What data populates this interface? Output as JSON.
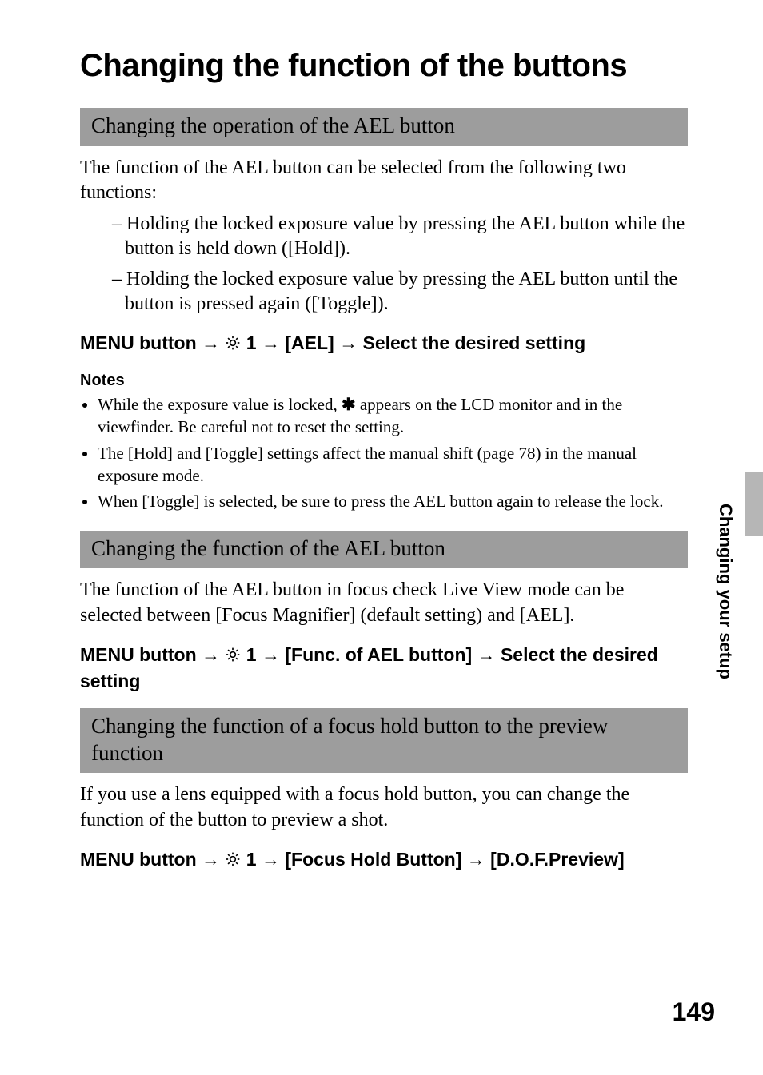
{
  "page_title": "Changing the function of the buttons",
  "side_tab": "Changing your setup",
  "page_number": "149",
  "sec1": {
    "bar": "Changing the operation of the AEL button",
    "intro": "The function of the AEL button can be selected from the following two functions:",
    "dash": [
      "Holding the locked exposure value by pressing the AEL button while the button is held down ([Hold]).",
      "Holding the locked exposure value by pressing the AEL button until the button is pressed again ([Toggle])."
    ],
    "path": {
      "p1": "MENU button ",
      "arrow": "→",
      "gear_num": " 1 ",
      "p2": "[AEL]",
      "p3": "Select the desired setting"
    },
    "notes_label": "Notes",
    "notes": {
      "n1a": "While the exposure value is locked, ",
      "n1b": " appears on the LCD monitor and in the viewfinder. Be careful not to reset the setting.",
      "n2": "The [Hold] and [Toggle] settings affect the manual shift (page 78) in the manual exposure mode.",
      "n3": "When [Toggle] is selected, be sure to press the AEL button again to release the lock."
    }
  },
  "sec2": {
    "bar": "Changing the function of the AEL button",
    "intro": "The function of the AEL button in focus check Live View mode can be selected between [Focus Magnifier] (default setting) and [AEL].",
    "path": {
      "p1": "MENU button ",
      "arrow": "→",
      "gear_num": " 1 ",
      "p2": "[Func. of AEL button]",
      "p3": "Select the desired setting"
    }
  },
  "sec3": {
    "bar": "Changing the function of a focus hold button to the preview function",
    "intro": "If you use a lens equipped with a focus hold button, you can change the function of the button to preview a shot.",
    "path": {
      "p1": "MENU button ",
      "arrow": "→",
      "gear_num": " 1 ",
      "p2": "[Focus Hold Button]",
      "p3": "[D.O.F.Preview]"
    }
  }
}
